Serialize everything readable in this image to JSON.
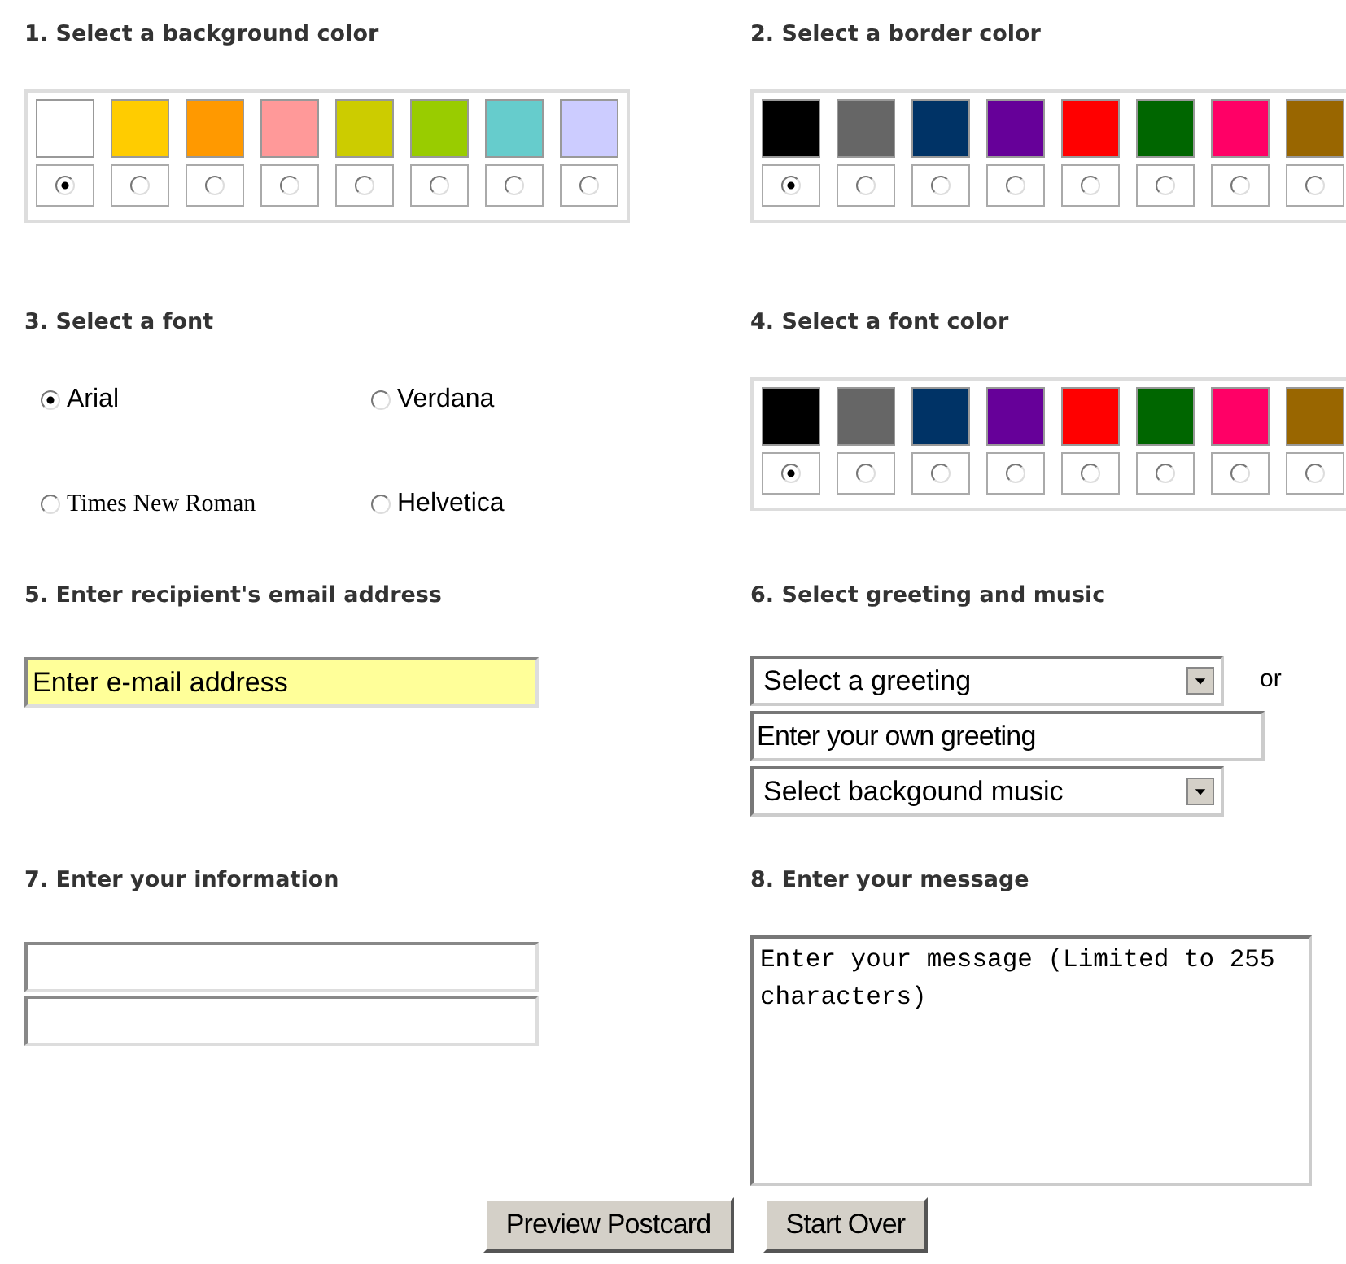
{
  "sections": [
    {
      "title": "1. Select a background color",
      "kind": "palette",
      "swatches": [
        {
          "color": "#ffffff",
          "selected": true
        },
        {
          "color": "#ffcc00",
          "selected": false
        },
        {
          "color": "#ff9900",
          "selected": false
        },
        {
          "color": "#ff9999",
          "selected": false
        },
        {
          "color": "#cccc00",
          "selected": false
        },
        {
          "color": "#99cc00",
          "selected": false
        },
        {
          "color": "#66cccc",
          "selected": false
        },
        {
          "color": "#ccccff",
          "selected": false
        }
      ]
    },
    {
      "title": "2. Select a border color",
      "kind": "palette",
      "swatches": [
        {
          "color": "#000000",
          "selected": true
        },
        {
          "color": "#666666",
          "selected": false
        },
        {
          "color": "#003366",
          "selected": false
        },
        {
          "color": "#660099",
          "selected": false
        },
        {
          "color": "#ff0000",
          "selected": false
        },
        {
          "color": "#006600",
          "selected": false
        },
        {
          "color": "#ff0066",
          "selected": false
        },
        {
          "color": "#996600",
          "selected": false
        }
      ]
    },
    {
      "title": "3. Select a font",
      "kind": "fonts",
      "options": [
        {
          "label": "Arial",
          "kind": "sans",
          "selected": true
        },
        {
          "label": "Verdana",
          "kind": "sans",
          "selected": false
        },
        {
          "label": "Times New Roman",
          "kind": "serif",
          "selected": false
        },
        {
          "label": "Helvetica",
          "kind": "sans",
          "selected": false
        }
      ]
    },
    {
      "title": "4. Select a font color",
      "kind": "palette",
      "swatches": [
        {
          "color": "#000000",
          "selected": true
        },
        {
          "color": "#666666",
          "selected": false
        },
        {
          "color": "#003366",
          "selected": false
        },
        {
          "color": "#660099",
          "selected": false
        },
        {
          "color": "#ff0000",
          "selected": false
        },
        {
          "color": "#006600",
          "selected": false
        },
        {
          "color": "#ff0066",
          "selected": false
        },
        {
          "color": "#996600",
          "selected": false
        }
      ]
    },
    {
      "title": "5. Enter recipient's email address",
      "kind": "fields",
      "fields": [
        {
          "value": "Enter e-mail address",
          "highlighted": true
        }
      ]
    },
    {
      "title": "6. Select greeting and music",
      "kind": "greeting",
      "controls": [
        {
          "kind": "select",
          "value": "Select a greeting",
          "suffix": "or"
        },
        {
          "kind": "input",
          "value": "Enter your own greeting"
        },
        {
          "kind": "select",
          "value": "Select backgound music"
        }
      ]
    },
    {
      "title": "7. Enter your information",
      "kind": "fields",
      "fields": [
        {
          "highlighted": false
        },
        {
          "highlighted": false
        }
      ]
    },
    {
      "title": "8. Enter your message",
      "kind": "message",
      "value": "Enter your message (Limited to 255 characters)"
    }
  ],
  "buttons": [
    "Preview Postcard",
    "Start Over"
  ]
}
